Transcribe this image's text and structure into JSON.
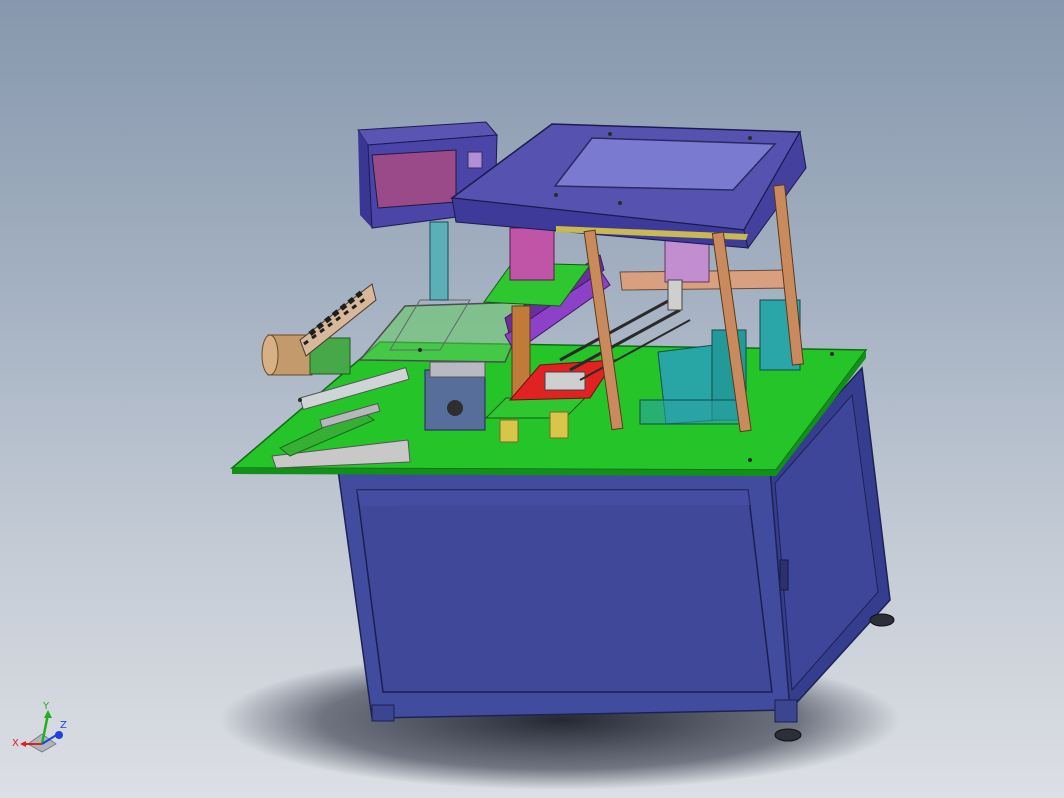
{
  "triad": {
    "x_label": "X",
    "y_label": "Y",
    "z_label": "Z",
    "x_color": "#e02020",
    "y_color": "#20b020",
    "z_color": "#2040e0"
  },
  "model": {
    "frame_color": "#404a9c",
    "table_color": "#22c02a",
    "top_cover_color": "#5656b0",
    "screen_color": "#8a6eb0",
    "column_color": "#b9825a",
    "icon": "3d-model-icon"
  }
}
